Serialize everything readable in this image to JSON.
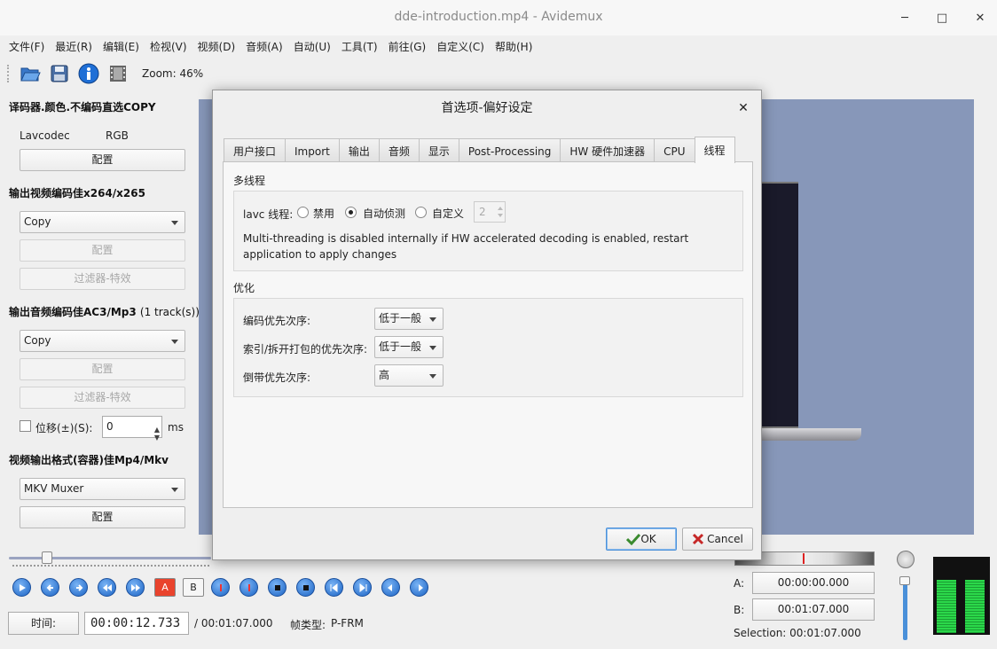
{
  "window": {
    "title": "dde-introduction.mp4 - Avidemux",
    "minimize_glyph": "─",
    "maximize_glyph": "□",
    "close_glyph": "✕"
  },
  "menu": [
    "文件(F)",
    "最近(R)",
    "编辑(E)",
    "检视(V)",
    "视频(D)",
    "音频(A)",
    "自动(U)",
    "工具(T)",
    "前往(G)",
    "自定义(C)",
    "帮助(H)"
  ],
  "toolbar": {
    "zoom": "Zoom: 46%",
    "icons": [
      "open-icon",
      "save-icon",
      "info-icon",
      "film-icon"
    ]
  },
  "left": {
    "decoder_title": "译码器.颜色.不编码直选COPY",
    "decoder_name": "Lavcodec",
    "decoder_color": "RGB",
    "decoder_config": "配置",
    "video_title": "输出视频编码佳x264/x265",
    "video_codec": "Copy",
    "video_config": "配置",
    "video_filters": "过滤器-特效",
    "audio_title": "输出音频编码佳AC3/Mp3",
    "audio_tracks": "(1 track(s))",
    "audio_codec": "Copy",
    "audio_config": "配置",
    "audio_filters": "过滤器-特效",
    "shift_label": "位移(±)(S):",
    "shift_checked": false,
    "shift_value": "0",
    "shift_unit": "ms",
    "container_title": "视频输出格式(容器)佳Mp4/Mkv",
    "muxer": "MKV Muxer",
    "muxer_config": "配置"
  },
  "dialog": {
    "title": "首选项-偏好设定",
    "close_glyph": "✕",
    "tabs": [
      "用户接口",
      "Import",
      "输出",
      "音频",
      "显示",
      "Post-Processing",
      "HW 硬件加速器",
      "CPU",
      "线程"
    ],
    "active_tab": "线程",
    "multithread": {
      "title": "多线程",
      "lavc_label": "lavc 线程:",
      "options": [
        "禁用",
        "自动侦测",
        "自定义"
      ],
      "selected": "自动侦测",
      "custom_value": "2",
      "note": "Multi-threading is disabled internally if HW accelerated decoding is enabled, restart application to apply changes"
    },
    "optimize": {
      "title": "优化",
      "rows": [
        {
          "label": "编码优先次序:",
          "value": "低于一般"
        },
        {
          "label": "索引/拆开打包的优先次序:",
          "value": "低于一般"
        },
        {
          "label": "倒带优先次序:",
          "value": "高"
        }
      ]
    },
    "ok": "OK",
    "cancel": "Cancel"
  },
  "playback": {
    "progress": 0.19,
    "time_button": "时间:",
    "current_time": "00:00:12.733",
    "total_time": "/ 00:01:07.000",
    "frame_type_label": "帧类型:",
    "frame_type": "P-FRM",
    "a_label": "A:",
    "a_time": "00:00:00.000",
    "b_label": "B:",
    "b_time": "00:01:07.000",
    "selection": "Selection: 00:01:07.000",
    "marker_a": "A",
    "marker_b": "B"
  }
}
